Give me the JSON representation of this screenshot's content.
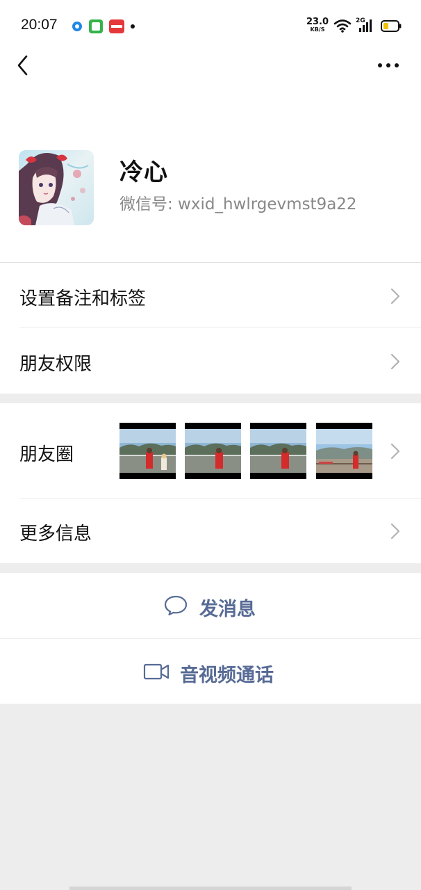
{
  "status_bar": {
    "time": "20:07",
    "net_speed_value": "23.0",
    "net_speed_unit": "KB/S",
    "network_type": "2G",
    "notification_icons": [
      "browser-icon",
      "calendar-app-icon",
      "toutiao-app-icon"
    ]
  },
  "nav": {
    "back_icon": "chevron-left-icon",
    "more_icon": "more-dots-icon"
  },
  "profile": {
    "name": "冷心",
    "wechat_id": "微信号:  wxid_hwlrgevmst9a22"
  },
  "menu": {
    "remark_tags": "设置备注和标签",
    "friend_permissions": "朋友权限",
    "moments": "朋友圈",
    "more_info": "更多信息"
  },
  "actions": {
    "send_message": "发消息",
    "video_call": "音视频通话"
  },
  "colors": {
    "link_blue": "#576b95",
    "background": "#ededed",
    "divider": "#ececec"
  }
}
